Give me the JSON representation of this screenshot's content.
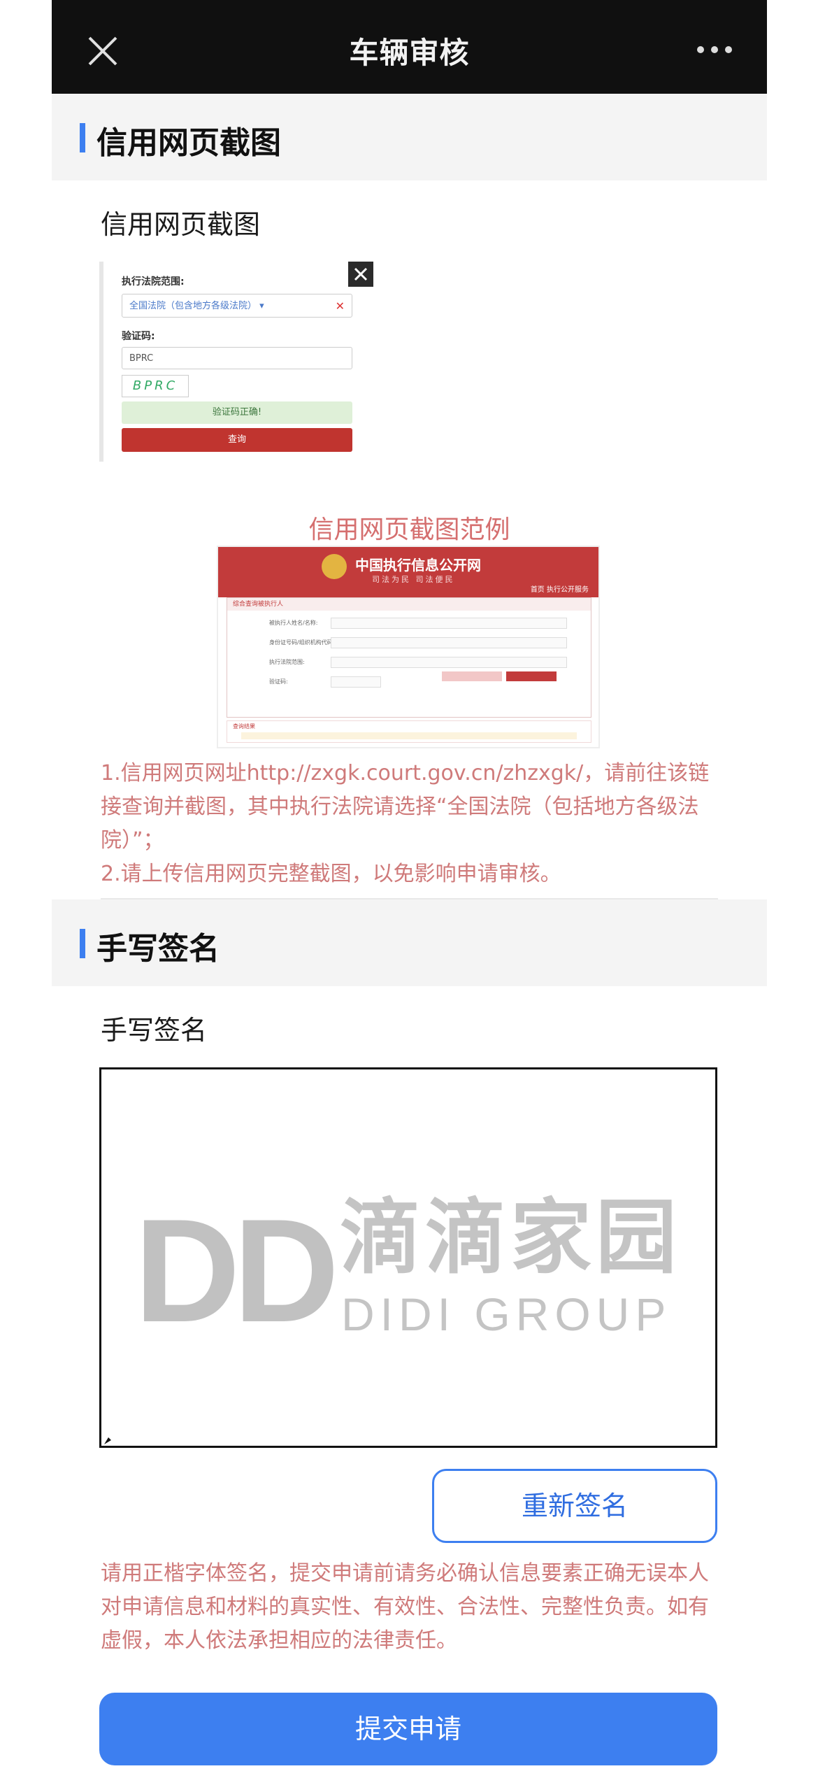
{
  "navbar": {
    "title": "车辆审核",
    "close_icon": "close-icon",
    "more_icon": "more-icon"
  },
  "credit_section": {
    "header": "信用网页截图",
    "field_label": "信用网页截图",
    "thumbnail": {
      "court_range_label": "执行法院范围:",
      "court_range_value": "全国法院（包含地方各级法院）",
      "captcha_label": "验证码:",
      "captcha_input": "BPRC",
      "captcha_image_text": "BPRC",
      "captcha_ok": "验证码正确!",
      "query_button": "查询"
    },
    "example_title": "信用网页截图范例",
    "example": {
      "site_title": "中国执行信息公开网",
      "site_slogan": "司法为民 司法便民",
      "nav": "首页  执行公开服务",
      "panel_title": "综合查询被执行人",
      "row1": "被执行人姓名/名称:",
      "row2": "身份证号码/组织机构代码:",
      "row3": "执行法院范围:",
      "row4": "验证码:",
      "result_title": "查询结果"
    },
    "notes": [
      "1.信用网页网址http://zxgk.court.gov.cn/zhzxgk/，请前往该链接查询并截图，其中执行法院请选择“全国法院（包括地方各级法院）”；",
      "2.请上传信用网页完整截图，以免影响申请审核。"
    ]
  },
  "signature_section": {
    "header": "手写签名",
    "field_label": "手写签名",
    "watermark_logo": "DD",
    "watermark_cn": "滴滴家园",
    "watermark_en": "DIDI GROUP",
    "resign_button": "重新签名",
    "disclaimer": "请用正楷字体签名，提交申请前请务必确认信息要素正确无误本人对申请信息和材料的真实性、有效性、合法性、完整性负责。如有虚假，本人依法承担相应的法律责任。",
    "submit_button": "提交申请"
  },
  "colors": {
    "accent": "#3d7ff0",
    "note_text": "#cf7a7a",
    "navbar_bg": "#101010"
  }
}
